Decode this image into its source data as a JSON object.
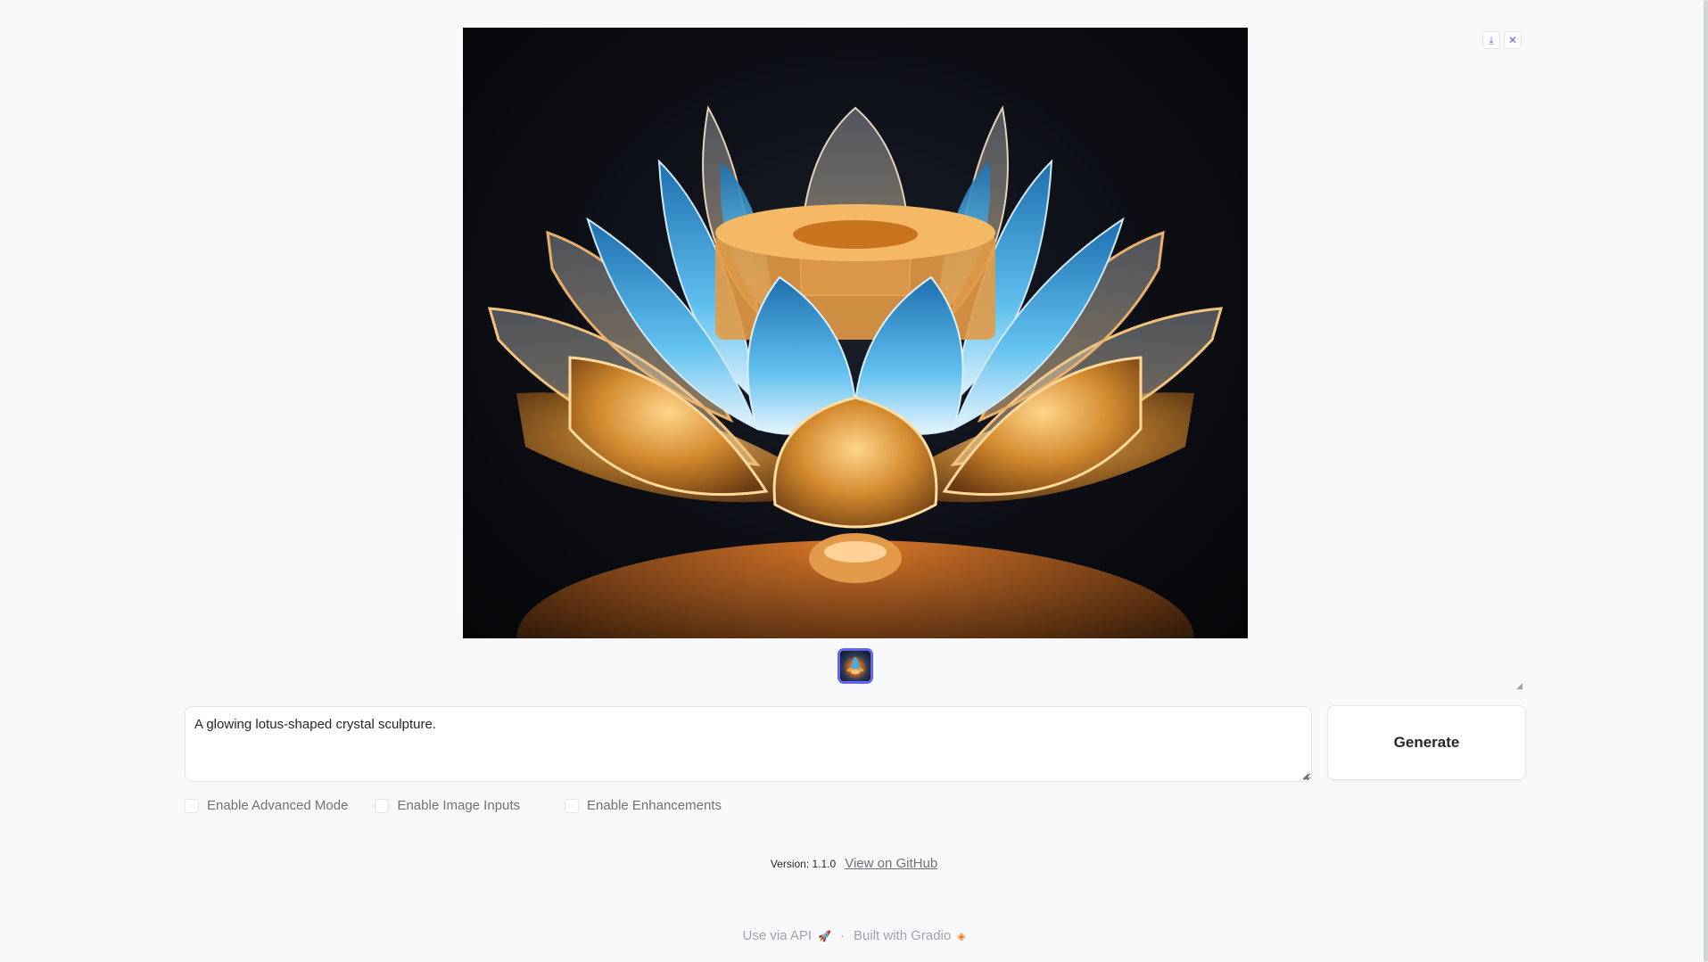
{
  "gallery": {
    "download_icon": "download-icon",
    "download_glyph": "⤓",
    "close_icon": "close-icon",
    "close_glyph": "✕"
  },
  "prompt": {
    "value": "A glowing lotus-shaped crystal sculpture."
  },
  "generate": {
    "label": "Generate"
  },
  "options": {
    "advanced_label": "Enable Advanced Mode",
    "image_inputs_label": "Enable Image Inputs",
    "enhancements_label": "Enable Enhancements"
  },
  "version": {
    "label": "Version: 1.1.0",
    "github_link": "View on GitHub"
  },
  "footer": {
    "api_link": "Use via API",
    "separator": "·",
    "built_with": "Built with Gradio"
  },
  "colors": {
    "accent": "#6366f1",
    "background": "#f8f9fb",
    "border": "#e4e4e7",
    "muted_text": "#71717a"
  }
}
